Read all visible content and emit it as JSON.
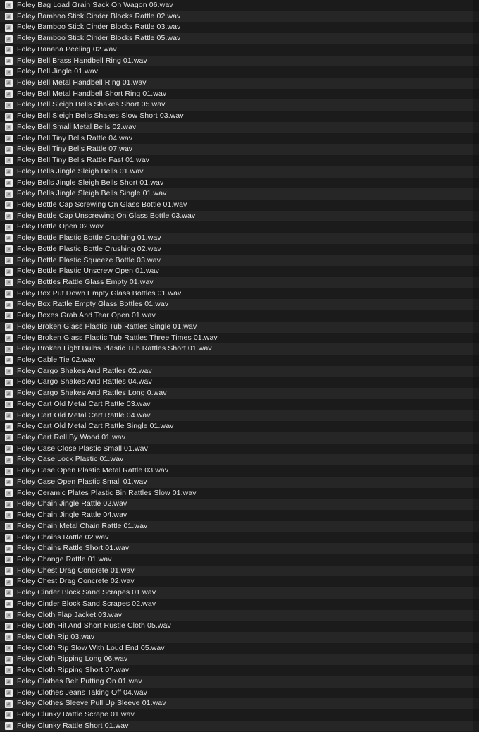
{
  "window": {
    "title": "Foley Audio File Browser",
    "view_mode": "list"
  },
  "colors": {
    "background": "#1c1c1c",
    "row_even": "#1b1b1b",
    "row_odd": "#262626",
    "text": "#e3e3e3",
    "icon_body": "#e9e9e9",
    "icon_sheet": "#b9b9b9"
  },
  "list": {
    "icon_name": "audio-file-icon",
    "total_visible_rows": 66,
    "files": [
      {
        "name": "Foley Bag Load Grain Sack On Wagon 06.wav"
      },
      {
        "name": "Foley Bamboo Stick Cinder Blocks Rattle 02.wav"
      },
      {
        "name": "Foley Bamboo Stick Cinder Blocks Rattle 03.wav"
      },
      {
        "name": "Foley Bamboo Stick Cinder Blocks Rattle 05.wav"
      },
      {
        "name": "Foley Banana Peeling 02.wav"
      },
      {
        "name": "Foley Bell Brass Handbell Ring 01.wav"
      },
      {
        "name": "Foley Bell Jingle 01.wav"
      },
      {
        "name": "Foley Bell Metal Handbell Ring 01.wav"
      },
      {
        "name": "Foley Bell Metal Handbell Short Ring 01.wav"
      },
      {
        "name": "Foley Bell Sleigh Bells Shakes Short 05.wav"
      },
      {
        "name": "Foley Bell Sleigh Bells Shakes Slow Short 03.wav"
      },
      {
        "name": "Foley Bell Small Metal Bells 02.wav"
      },
      {
        "name": "Foley Bell Tiny Bells Rattle 04.wav"
      },
      {
        "name": "Foley Bell Tiny Bells Rattle 07.wav"
      },
      {
        "name": "Foley Bell Tiny Bells Rattle Fast 01.wav"
      },
      {
        "name": "Foley Bells Jingle Sleigh Bells 01.wav"
      },
      {
        "name": "Foley Bells Jingle Sleigh Bells Short 01.wav"
      },
      {
        "name": "Foley Bells Jingle Sleigh Bells Single 01.wav"
      },
      {
        "name": "Foley Bottle Cap Screwing On Glass Bottle 01.wav"
      },
      {
        "name": "Foley Bottle Cap Unscrewing On Glass Bottle 03.wav"
      },
      {
        "name": "Foley Bottle Open 02.wav"
      },
      {
        "name": "Foley Bottle Plastic Bottle Crushing 01.wav"
      },
      {
        "name": "Foley Bottle Plastic Bottle Crushing 02.wav"
      },
      {
        "name": "Foley Bottle Plastic Squeeze Bottle 03.wav"
      },
      {
        "name": "Foley Bottle Plastic Unscrew Open 01.wav"
      },
      {
        "name": "Foley Bottles Rattle Glass Empty 01.wav"
      },
      {
        "name": "Foley Box Put Down Empty Glass Bottles 01.wav"
      },
      {
        "name": "Foley Box Rattle Empty Glass Bottles 01.wav"
      },
      {
        "name": "Foley Boxes Grab And Tear Open 01.wav"
      },
      {
        "name": "Foley Broken Glass Plastic Tub Rattles Single 01.wav"
      },
      {
        "name": "Foley Broken Glass Plastic Tub Rattles Three Times 01.wav"
      },
      {
        "name": "Foley Broken Light Bulbs Plastic Tub Rattles Short 01.wav"
      },
      {
        "name": "Foley Cable Tie 02.wav"
      },
      {
        "name": "Foley Cargo Shakes And Rattles 02.wav"
      },
      {
        "name": "Foley Cargo Shakes And Rattles 04.wav"
      },
      {
        "name": "Foley Cargo Shakes And Rattles Long 0.wav"
      },
      {
        "name": "Foley Cart Old Metal Cart Rattle 03.wav"
      },
      {
        "name": "Foley Cart Old Metal Cart Rattle 04.wav"
      },
      {
        "name": "Foley Cart Old Metal Cart Rattle Single 01.wav"
      },
      {
        "name": "Foley Cart Roll By Wood 01.wav"
      },
      {
        "name": "Foley Case Close Plastic Small 01.wav"
      },
      {
        "name": "Foley Case Lock Plastic 01.wav"
      },
      {
        "name": "Foley Case Open Plastic Metal Rattle 03.wav"
      },
      {
        "name": "Foley Case Open Plastic Small 01.wav"
      },
      {
        "name": "Foley Ceramic Plates Plastic Bin Rattles Slow 01.wav"
      },
      {
        "name": "Foley Chain Jingle Rattle 02.wav"
      },
      {
        "name": "Foley Chain Jingle Rattle 04.wav"
      },
      {
        "name": "Foley Chain Metal Chain Rattle 01.wav"
      },
      {
        "name": "Foley Chains Rattle 02.wav"
      },
      {
        "name": "Foley Chains Rattle Short 01.wav"
      },
      {
        "name": "Foley Change Rattle 01.wav"
      },
      {
        "name": "Foley Chest Drag Concrete 01.wav"
      },
      {
        "name": "Foley Chest Drag Concrete 02.wav"
      },
      {
        "name": "Foley Cinder Block Sand Scrapes 01.wav"
      },
      {
        "name": "Foley Cinder Block Sand Scrapes 02.wav"
      },
      {
        "name": "Foley Cloth Flap Jacket 03.wav"
      },
      {
        "name": "Foley Cloth Hit And Short Rustle Cloth 05.wav"
      },
      {
        "name": "Foley Cloth Rip 03.wav"
      },
      {
        "name": "Foley Cloth Rip Slow With Loud End 05.wav"
      },
      {
        "name": "Foley Cloth Ripping Long 06.wav"
      },
      {
        "name": "Foley Cloth Ripping Short 07.wav"
      },
      {
        "name": "Foley Clothes Belt Putting On 01.wav"
      },
      {
        "name": "Foley Clothes Jeans Taking Off 04.wav"
      },
      {
        "name": "Foley Clothes Sleeve Pull Up Sleeve 01.wav"
      },
      {
        "name": "Foley Clunky Rattle Scrape 01.wav"
      },
      {
        "name": "Foley Clunky Rattle Short 01.wav"
      }
    ]
  }
}
